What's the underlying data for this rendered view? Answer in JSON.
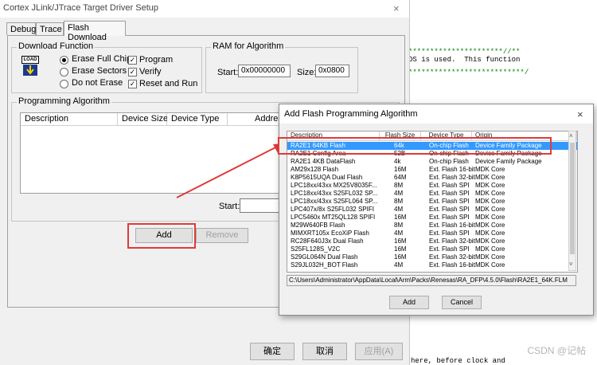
{
  "editor": {
    "line1": "**********************//**",
    "line2": "OS is used.  This function",
    "line3": "***************************/",
    "line4": "here, before clock and"
  },
  "watermark": "CSDN @记帖",
  "main_dialog": {
    "title": "Cortex JLink/JTrace Target Driver Setup",
    "close": "×",
    "tabs": [
      "Debug",
      "Trace",
      "Flash Download"
    ],
    "download_function": {
      "label": "Download Function",
      "load_icon_text": "LOAD",
      "radios": [
        "Erase Full Chip",
        "Erase Sectors",
        "Do not Erase"
      ],
      "checks": [
        "Program",
        "Verify",
        "Reset and Run"
      ]
    },
    "ram": {
      "label": "RAM for Algorithm",
      "start_label": "Start:",
      "start_value": "0x00000000",
      "size_label": "Size:",
      "size_value": "0x0800"
    },
    "programming_algorithm": {
      "label": "Programming Algorithm",
      "columns": [
        "Description",
        "Device Size",
        "Device Type",
        "Address"
      ],
      "start_label": "Start:"
    },
    "buttons": {
      "add": "Add",
      "remove": "Remove",
      "ok": "确定",
      "cancel": "取消",
      "apply": "应用(A)"
    }
  },
  "flash_dialog": {
    "title": "Add Flash Programming Algorithm",
    "close": "×",
    "columns": [
      "Description",
      "Flash Size",
      "Device Type",
      "Origin"
    ],
    "rows": [
      [
        "RA2E1 64KB Flash",
        "64k",
        "On-chip Flash",
        "Device Family Package"
      ],
      [
        "RA2E1 Config Area",
        "52B",
        "On-chip Flash",
        "Device Family Package"
      ],
      [
        "RA2E1 4KB DataFlash",
        "4k",
        "On-chip Flash",
        "Device Family Package"
      ],
      [
        "AM29x128 Flash",
        "16M",
        "Ext. Flash 16-bit",
        "MDK Core"
      ],
      [
        "K8P5615UQA Dual Flash",
        "64M",
        "Ext. Flash 32-bit",
        "MDK Core"
      ],
      [
        "LPC18xx/43xx MX25V8035F...",
        "8M",
        "Ext. Flash SPI",
        "MDK Core"
      ],
      [
        "LPC18xx/43xx S25FL032 SP...",
        "4M",
        "Ext. Flash SPI",
        "MDK Core"
      ],
      [
        "LPC18xx/43xx S25FL064 SP...",
        "8M",
        "Ext. Flash SPI",
        "MDK Core"
      ],
      [
        "LPC407x/8x S25FL032 SPIFI",
        "4M",
        "Ext. Flash SPI",
        "MDK Core"
      ],
      [
        "LPC5460x MT25QL128 SPIFI",
        "16M",
        "Ext. Flash SPI",
        "MDK Core"
      ],
      [
        "M29W640FB Flash",
        "8M",
        "Ext. Flash 16-bit",
        "MDK Core"
      ],
      [
        "MIMXRT105x EcoXiP Flash",
        "4M",
        "Ext. Flash SPI",
        "MDK Core"
      ],
      [
        "RC28F640J3x Dual Flash",
        "16M",
        "Ext. Flash 32-bit",
        "MDK Core"
      ],
      [
        "S25FL128S_V2C",
        "16M",
        "Ext. Flash SPI",
        "MDK Core"
      ],
      [
        "S29GL064N Dual Flash",
        "16M",
        "Ext. Flash 32-bit",
        "MDK Core"
      ],
      [
        "S29JL032H_BOT Flash",
        "4M",
        "Ext. Flash 16-bit",
        "MDK Core"
      ]
    ],
    "path": "C:\\Users\\Administrator\\AppData\\Local\\Arm\\Packs\\Renesas\\RA_DFP\\4.5.0\\Flash\\RA2E1_64K.FLM",
    "buttons": {
      "add": "Add",
      "cancel": "Cancel"
    }
  },
  "colors": {
    "highlight": "#3399ff",
    "annotation": "#e03a3a"
  }
}
